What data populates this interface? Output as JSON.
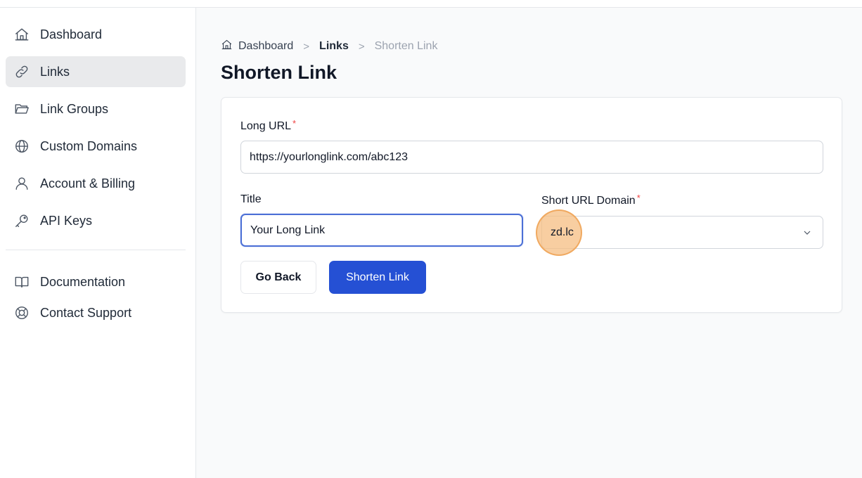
{
  "sidebar": {
    "items": [
      {
        "label": "Dashboard",
        "icon": "home-icon"
      },
      {
        "label": "Links",
        "icon": "link-icon",
        "active": true
      },
      {
        "label": "Link Groups",
        "icon": "folder-icon"
      },
      {
        "label": "Custom Domains",
        "icon": "globe-icon"
      },
      {
        "label": "Account & Billing",
        "icon": "user-icon"
      },
      {
        "label": "API Keys",
        "icon": "key-icon"
      }
    ],
    "secondary": [
      {
        "label": "Documentation",
        "icon": "book-icon"
      },
      {
        "label": "Contact Support",
        "icon": "lifebuoy-icon"
      }
    ]
  },
  "breadcrumb": {
    "items": [
      "Dashboard",
      "Links",
      "Shorten Link"
    ]
  },
  "page": {
    "title": "Shorten Link"
  },
  "form": {
    "long_url_label": "Long URL",
    "long_url_value": "https://yourlonglink.com/abc123",
    "title_label": "Title",
    "title_value": "Your Long Link",
    "domain_label": "Short URL Domain",
    "domain_value": "zd.lc",
    "required_mark": "*",
    "go_back_label": "Go Back",
    "submit_label": "Shorten Link"
  },
  "colors": {
    "accent": "#2550d4",
    "required": "#ef4444",
    "highlight": "#f6be82"
  }
}
